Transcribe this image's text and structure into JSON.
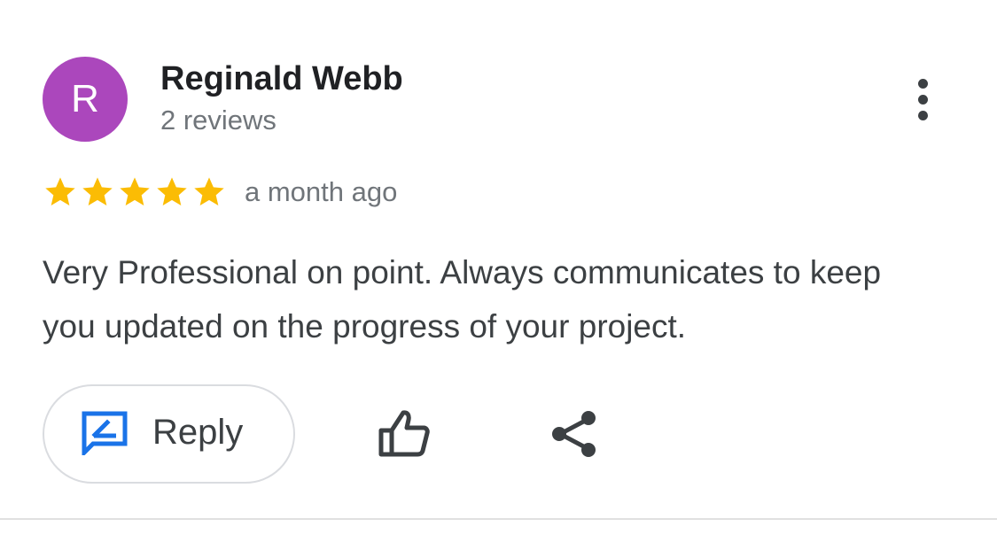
{
  "reviewer": {
    "initial": "R",
    "name": "Reginald Webb",
    "review_count": "2 reviews",
    "avatar_color": "#ab47bc"
  },
  "review": {
    "rating": 5,
    "max_rating": 5,
    "time_ago": "a month ago",
    "text": "Very Professional on point. Always communicates to keep you updated on the progress of your project.",
    "star_color": "#fbbc04"
  },
  "actions": {
    "reply_label": "Reply",
    "reply_icon": "reply-edit-icon",
    "reply_icon_color": "#1a73e8",
    "like_icon": "thumbs-up-icon",
    "share_icon": "share-icon",
    "more_icon": "more-vert-icon"
  }
}
